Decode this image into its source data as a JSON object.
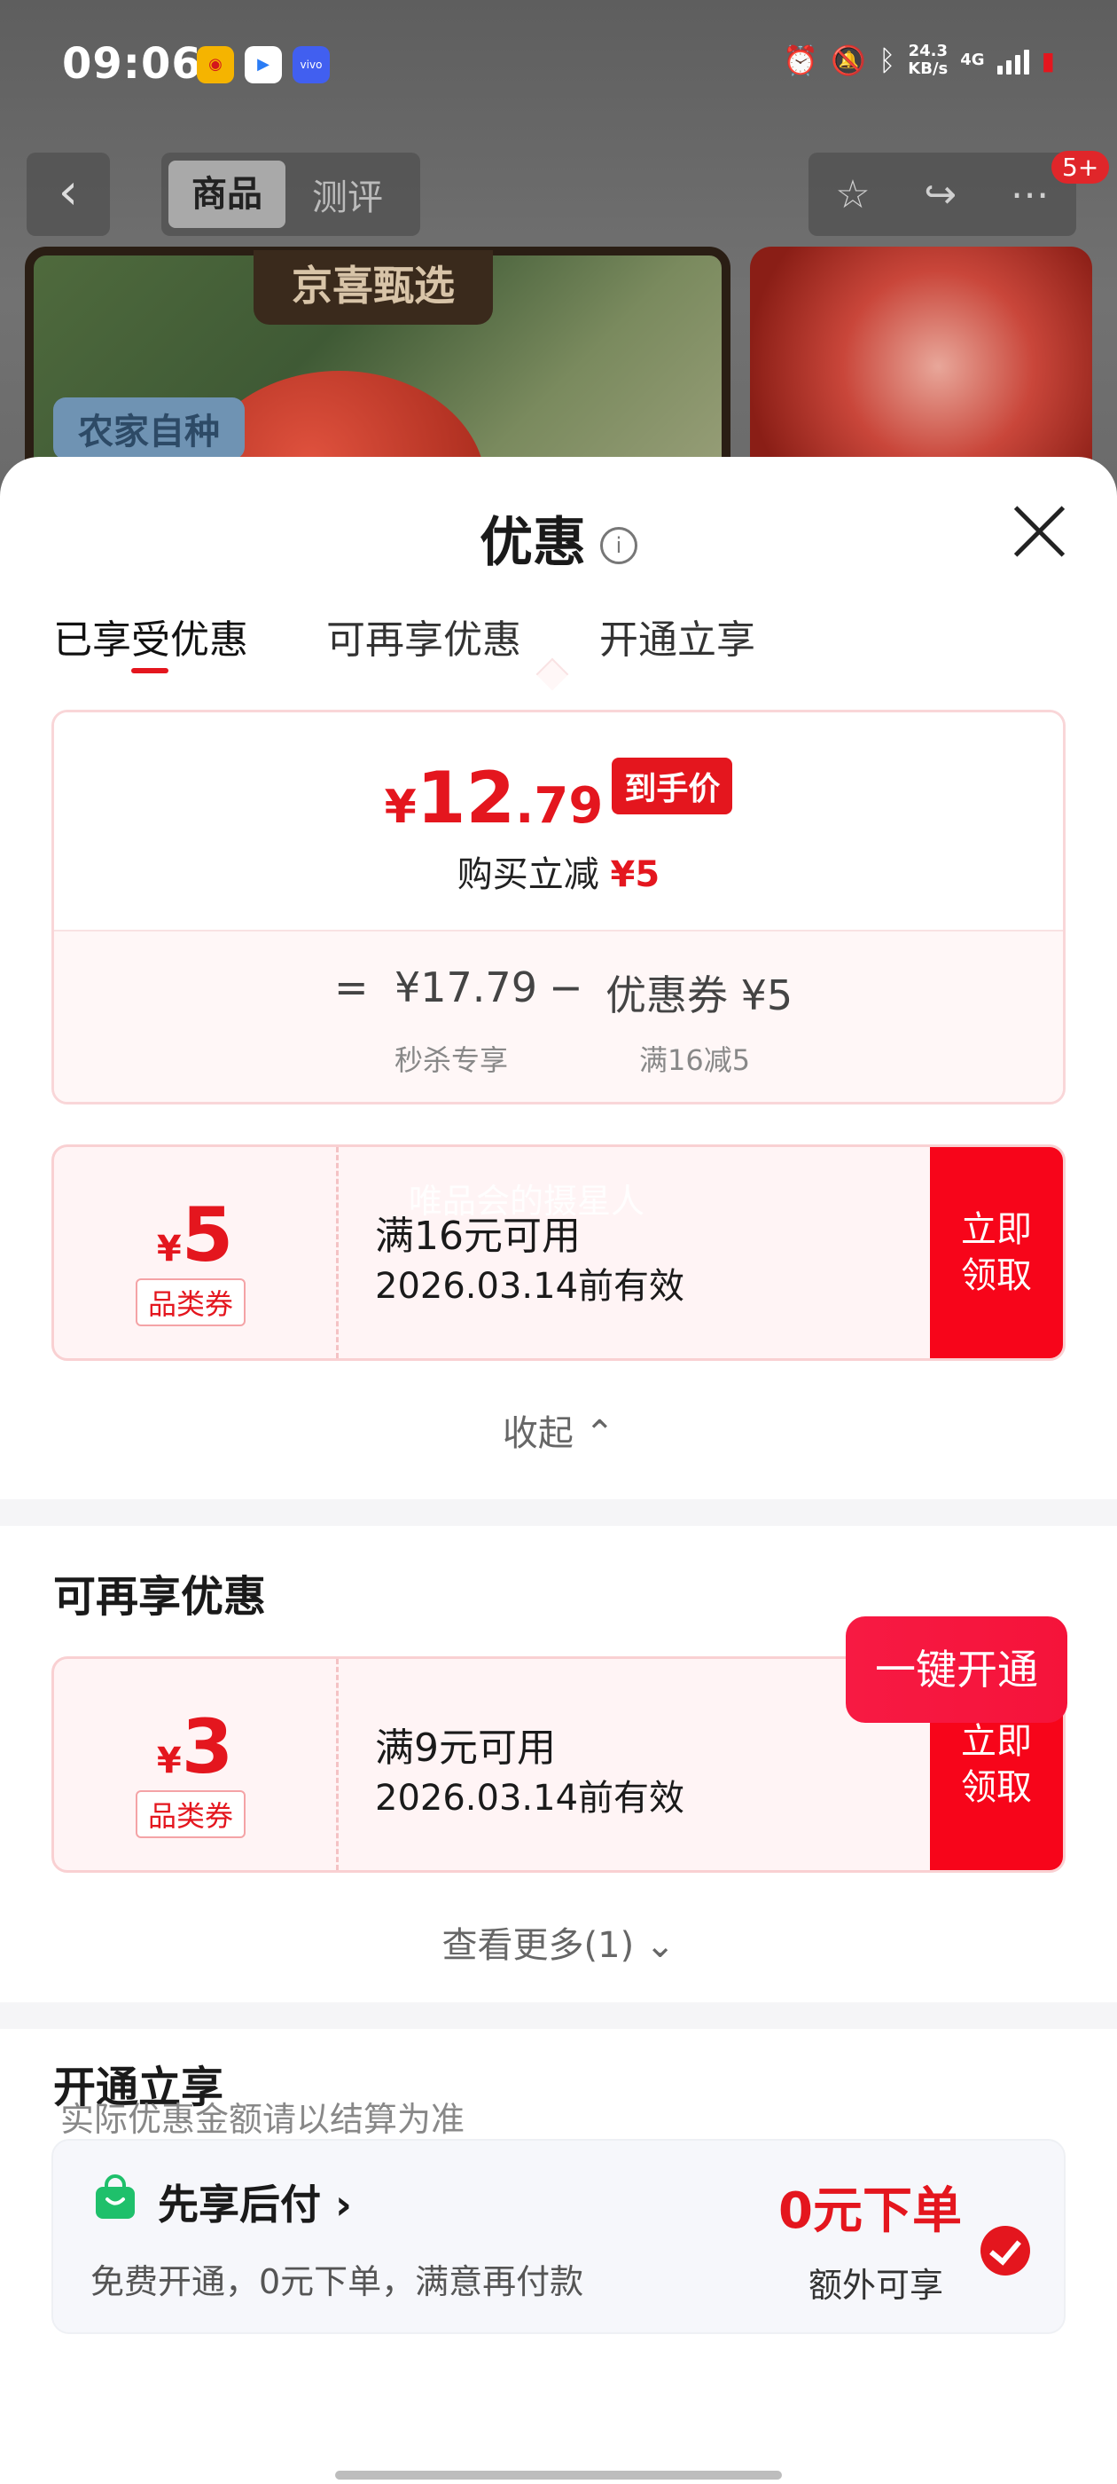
{
  "status_bar": {
    "time": "09:06",
    "net_speed_value": "24.3",
    "net_speed_unit": "KB/s",
    "network": "4G"
  },
  "nav": {
    "tab_goods": "商品",
    "tab_review": "测评",
    "badge": "5+"
  },
  "product_images": {
    "brand_label": "京喜甄选",
    "farm_tag": "农家自种"
  },
  "sheet": {
    "title": "优惠",
    "tabs": [
      "已享受优惠",
      "可再享优惠",
      "开通立享"
    ]
  },
  "price_summary": {
    "currency": "¥",
    "final_int": "12",
    "final_dec": ".79",
    "final_tag": "到手价",
    "reduce_label": "购买立减",
    "reduce_amount": "¥5",
    "equals": "=",
    "original_price": "¥17.79",
    "minus": "−",
    "coupon_label": "优惠券 ¥5",
    "original_sub": "秒杀专享",
    "coupon_sub": "满16减5"
  },
  "coupons_enjoyed": [
    {
      "currency": "¥",
      "amount": "5",
      "type": "品类券",
      "condition": "满16元可用",
      "validity": "2026.03.14前有效",
      "claim_label": "立即\n领取"
    }
  ],
  "watermark": "唯品会的摄星人",
  "collapse_label": "收起 ⌃",
  "more_section": {
    "title": "可再享优惠",
    "coupons": [
      {
        "currency": "¥",
        "amount": "3",
        "type": "品类券",
        "condition": "满9元可用",
        "validity": "2026.03.14前有效",
        "claim_label": "立即\n领取"
      }
    ],
    "see_more": "查看更多(1) ⌄"
  },
  "open_section": {
    "title": "开通立享",
    "button": "一键开通",
    "hint": "实际优惠金额请以结算为准",
    "pay_later": {
      "title": "先享后付 ›",
      "desc": "免费开通，0元下单，满意再付款",
      "highlight": "0元下单",
      "extra": "额外可享"
    }
  },
  "colors": {
    "accent_red": "#e4161e",
    "claim_red": "#f7051a",
    "pay_green": "#1fc06b"
  }
}
